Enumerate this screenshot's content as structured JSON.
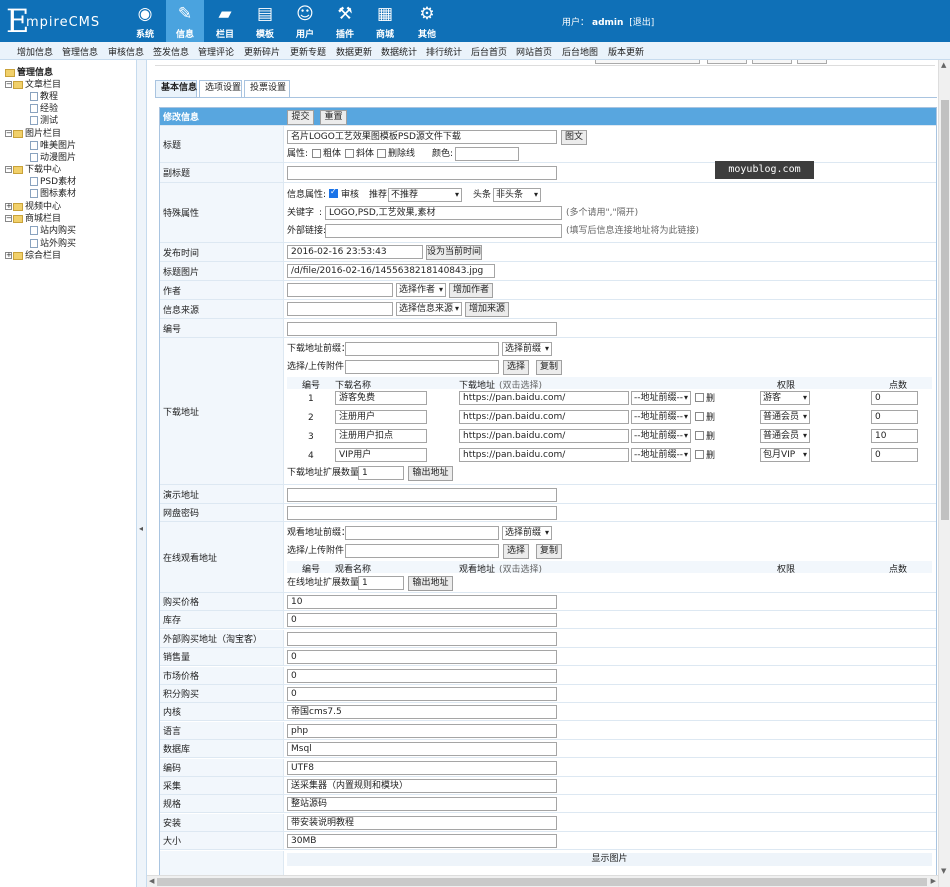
{
  "header": {
    "logo_big": "E",
    "logo_rest": "mpireCMS",
    "nav": [
      {
        "label": "系统",
        "icon": "globe-icon",
        "glyph": "◉"
      },
      {
        "label": "信息",
        "icon": "edit-icon",
        "glyph": "✎"
      },
      {
        "label": "栏目",
        "icon": "folder-icon",
        "glyph": "▰"
      },
      {
        "label": "模板",
        "icon": "template-icon",
        "glyph": "▤"
      },
      {
        "label": "用户",
        "icon": "user-icon",
        "glyph": "☺"
      },
      {
        "label": "插件",
        "icon": "plugin-icon",
        "glyph": "⚒"
      },
      {
        "label": "商城",
        "icon": "shop-icon",
        "glyph": "▦"
      },
      {
        "label": "其他",
        "icon": "gear-icon",
        "glyph": "⚙"
      }
    ],
    "active_nav": "信息",
    "user_prefix": "用户：",
    "username": "admin",
    "logout": "[退出]"
  },
  "submenu": [
    "增加信息",
    "管理信息",
    "审核信息",
    "签发信息",
    "管理评论",
    "更新碎片",
    "更新专题",
    "数据更新",
    "数据统计",
    "排行统计",
    "后台首页",
    "网站首页",
    "后台地图",
    "版本更新"
  ],
  "sidebar": {
    "root": "管理信息",
    "items": [
      {
        "label": "文章栏目",
        "type": "folder"
      },
      {
        "label": "教程",
        "type": "doc"
      },
      {
        "label": "经验",
        "type": "doc"
      },
      {
        "label": "测试",
        "type": "doc"
      },
      {
        "label": "图片栏目",
        "type": "folder"
      },
      {
        "label": "唯美图片",
        "type": "doc"
      },
      {
        "label": "动漫图片",
        "type": "doc"
      },
      {
        "label": "下载中心",
        "type": "folder"
      },
      {
        "label": "PSD素材",
        "type": "doc"
      },
      {
        "label": "图标素材",
        "type": "doc"
      },
      {
        "label": "视频中心",
        "type": "folder"
      },
      {
        "label": "商城栏目",
        "type": "folder"
      },
      {
        "label": "站内购买",
        "type": "doc"
      },
      {
        "label": "站外购买",
        "type": "doc"
      },
      {
        "label": "综合栏目",
        "type": "folder"
      }
    ]
  },
  "tabs": [
    "基本信息",
    "选项设置",
    "投票设置"
  ],
  "form": {
    "header_label": "修改信息",
    "submit": "提交",
    "reset": "重置",
    "title_label": "标题",
    "title_value": "名片LOGO工艺效果图模板PSD源文件下载",
    "title_image_btn": "图文",
    "attr_label": "属性:",
    "attr_bold": "粗体",
    "attr_italic": "斜体",
    "attr_strike": "删除线",
    "attr_color": "颜色:",
    "subtitle_label": "副标题",
    "special_label": "特殊属性",
    "info_attr": "信息属性:",
    "audit": "审核",
    "recommend": "推荐",
    "recommend_value": "不推荐",
    "headline": "头条",
    "headline_value": "非头条",
    "keywords_label": "关键字",
    "keywords_value": "LOGO,PSD,工艺效果,素材",
    "keywords_hint": "(多个请用\",\"隔开)",
    "external_label": "外部链接:",
    "external_hint": "(填写后信息连接地址将为此链接)",
    "publish_label": "发布时间",
    "publish_value": "2016-02-16 23:53:43",
    "set_now": "设为当前时间",
    "titlepic_label": "标题图片",
    "titlepic_value": "/d/file/2016-02-16/14556382181408​43.jpg",
    "author_label": "作者",
    "author_select": "选择作者",
    "author_add": "增加作者",
    "source_label": "信息来源",
    "source_select": "选择信息来源",
    "source_add": "增加来源",
    "number_label": "编号",
    "download_label": "下载地址",
    "dl_prefix": "下载地址前缀：",
    "dl_prefix_select": "选择前缀",
    "dl_upload": "选择/上传附件:",
    "dl_choose": "选择",
    "dl_copy": "复制",
    "dl_cols": [
      "编号",
      "下载名称",
      "下载地址",
      "(双击选择)",
      "权限",
      "点数"
    ],
    "dl_rows": [
      {
        "no": "1",
        "name": "游客免费",
        "url": "https://pan.baidu.com/",
        "prefix": "--地址前缀--",
        "del": "删",
        "perm": "游客",
        "points": "0"
      },
      {
        "no": "2",
        "name": "注册用户",
        "url": "https://pan.baidu.com/",
        "prefix": "--地址前缀--",
        "del": "删",
        "perm": "普通会员",
        "points": "0"
      },
      {
        "no": "3",
        "name": "注册用户扣点",
        "url": "https://pan.baidu.com/",
        "prefix": "--地址前缀--",
        "del": "删",
        "perm": "普通会员",
        "points": "10"
      },
      {
        "no": "4",
        "name": "VIP用户",
        "url": "https://pan.baidu.com/",
        "prefix": "--地址前缀--",
        "del": "删",
        "perm": "包月VIP",
        "points": "0"
      }
    ],
    "dl_expand": "下载地址扩展数量:",
    "dl_expand_value": "1",
    "dl_output": "输出地址",
    "demo_label": "演示地址",
    "pan_label": "网盘密码",
    "online_label": "在线观看地址",
    "ol_prefix": "观看地址前缀：",
    "ol_prefix_select": "选择前缀",
    "ol_upload": "选择/上传附件:",
    "ol_choose": "选择",
    "ol_copy": "复制",
    "ol_cols": [
      "编号",
      "观看名称",
      "观看地址",
      "(双击选择)",
      "权限",
      "点数"
    ],
    "ol_expand": "在线地址扩展数量:",
    "ol_expand_value": "1",
    "ol_output": "输出地址",
    "fields": [
      {
        "label": "购买价格",
        "value": "10"
      },
      {
        "label": "库存",
        "value": "0"
      },
      {
        "label": "外部购买地址（淘宝客）",
        "value": ""
      },
      {
        "label": "销售量",
        "value": "0"
      },
      {
        "label": "市场价格",
        "value": "0"
      },
      {
        "label": "积分购买",
        "value": "0"
      },
      {
        "label": "内核",
        "value": "帝国cms7.5"
      },
      {
        "label": "语言",
        "value": "php"
      },
      {
        "label": "数据库",
        "value": "Msql"
      },
      {
        "label": "编码",
        "value": "UTF8"
      },
      {
        "label": "采集",
        "value": "送采集器（内置规则和模块）"
      },
      {
        "label": "规格",
        "value": "整站源码"
      },
      {
        "label": "安装",
        "value": "带安装说明教程"
      },
      {
        "label": "大小",
        "value": "30MB"
      }
    ],
    "show_pic": "显示图片"
  },
  "watermark": "moyublog.com",
  "colors": {
    "topbar": "#0f70b7",
    "active_nav": "#4aa3df",
    "header_row": "#58a6df"
  }
}
